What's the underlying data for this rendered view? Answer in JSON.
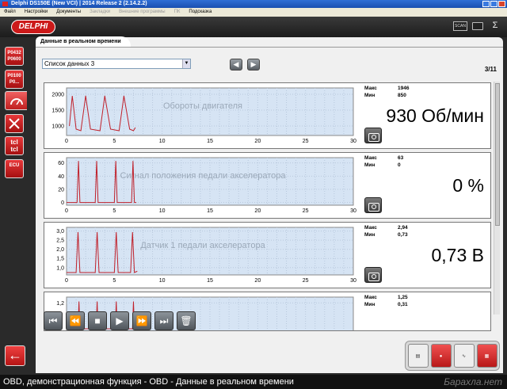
{
  "window": {
    "title": "Delphi DS150E (New VCI) | 2014 Release 2 (2.14.2.2)"
  },
  "menu": {
    "items": [
      "Файл",
      "Настройки",
      "Документы",
      "Закладки",
      "Внешние программы",
      "ПК",
      "Подсказка"
    ]
  },
  "header": {
    "logo": "DELPHI",
    "icon1": "SCAN",
    "brand": "Ʃ"
  },
  "sidebar": {
    "buttons": [
      "P0432\nP0600",
      "P0100\nP0...",
      "",
      "",
      "tcl\ntcl",
      "ECU"
    ]
  },
  "tab": {
    "label": "Данные в реальном времени"
  },
  "list_select": {
    "value": "Список данных 3",
    "arrow": "▼"
  },
  "nav": {
    "prev": "◀",
    "next": "▶"
  },
  "page_indicator": "3/11",
  "labels": {
    "max": "Макс",
    "min": "Мин"
  },
  "panels": [
    {
      "name": "Обороты двигателя",
      "max": "1946",
      "min": "850",
      "value": "930 Об/мин",
      "yticks": [
        "2000",
        "1500",
        "1000"
      ],
      "xticks": [
        "0",
        "5",
        "10",
        "15",
        "20",
        "25",
        "30"
      ]
    },
    {
      "name": "Сигнал положения педали акселератора",
      "max": "63",
      "min": "0",
      "value": "0 %",
      "yticks": [
        "60",
        "40",
        "20",
        "0"
      ],
      "xticks": [
        "0",
        "5",
        "10",
        "15",
        "20",
        "25",
        "30"
      ]
    },
    {
      "name": "Датчик 1 педали акселератора",
      "max": "2,94",
      "min": "0,73",
      "value": "0,73 В",
      "yticks": [
        "3,0",
        "2,5",
        "2,0",
        "1,5",
        "1,0"
      ],
      "xticks": [
        "0",
        "5",
        "10",
        "15",
        "20",
        "25",
        "30"
      ]
    },
    {
      "name": "",
      "max": "1,25",
      "min": "0,31",
      "value": "",
      "yticks": [
        "1,2"
      ],
      "xticks": []
    }
  ],
  "controls": [
    "⏮",
    "⏪",
    "■",
    "▶",
    "⏩",
    "⏭",
    "🗑"
  ],
  "back_button": "←",
  "status": {
    "text": "OBD, демонстрационная функция - OBD - Данные в реальном времени",
    "watermark": "Барахла.нет"
  },
  "colors": {
    "brand_red": "#cc1a1a",
    "plot_bg": "#d6e4f4",
    "trace": "#c0202a"
  }
}
